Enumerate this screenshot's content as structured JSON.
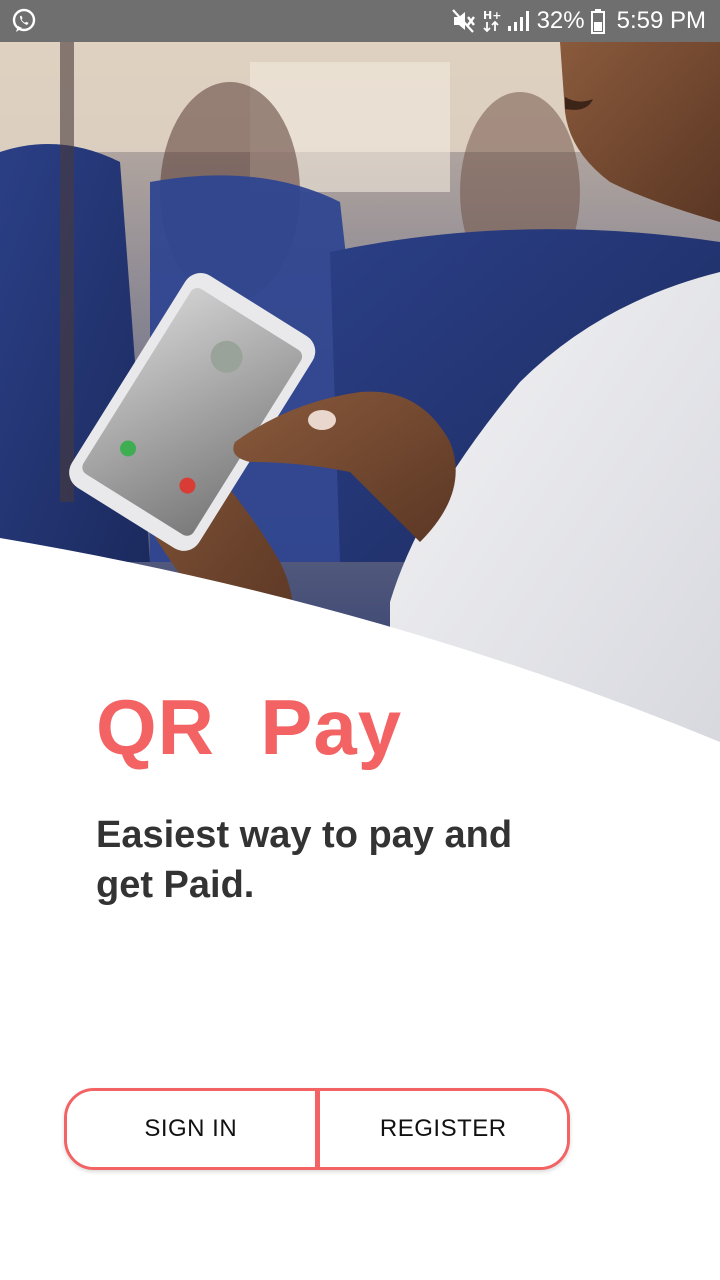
{
  "status_bar": {
    "battery_percent": "32%",
    "time": "5:59 PM",
    "icons": [
      "whatsapp-icon",
      "mute-icon",
      "network-hplus-icon",
      "signal-icon",
      "battery-icon"
    ]
  },
  "hero": {
    "image": "photo-woman-using-smartphone"
  },
  "app": {
    "title": "QR  Pay",
    "tagline": "Easiest way to pay and get Paid."
  },
  "actions": {
    "sign_in_label": "SIGN IN",
    "register_label": "REGISTER"
  },
  "colors": {
    "accent": "#f36364",
    "text_dark": "#333333",
    "status_bar": "#6f6f6f"
  }
}
